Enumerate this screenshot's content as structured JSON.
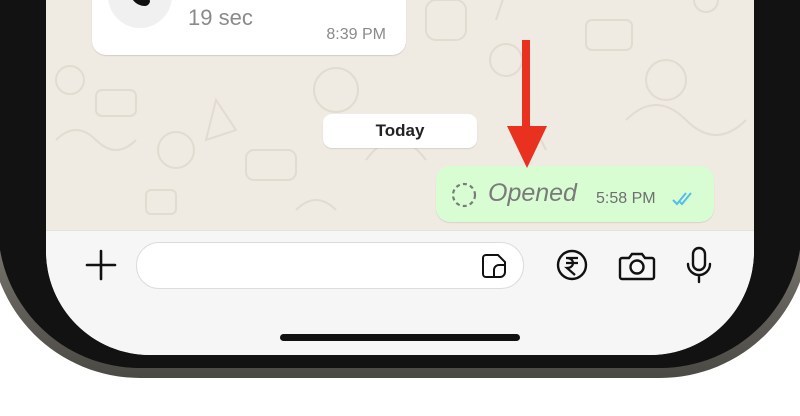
{
  "chat": {
    "call_bubble": {
      "icon": "incoming-call-icon",
      "duration": "19 sec",
      "time": "8:39 PM"
    },
    "date_separator": "Today",
    "outgoing_message": {
      "status_icon": "view-once-opened-icon",
      "status_text": "Opened",
      "time": "5:58 PM",
      "read_receipt": "double-check-read-icon",
      "read_receipt_color": "#53bdeb",
      "bubble_color": "#d9fdd3"
    }
  },
  "composer": {
    "attach_icon": "plus-icon",
    "input_value": "",
    "input_placeholder": "",
    "sticker_icon": "sticker-icon",
    "payment_icon": "rupee-icon",
    "camera_icon": "camera-icon",
    "mic_icon": "microphone-icon"
  },
  "annotation": {
    "type": "arrow",
    "color": "#e8311f"
  },
  "colors": {
    "chat_background": "#efeae2",
    "input_bar_background": "#f6f6f6"
  }
}
